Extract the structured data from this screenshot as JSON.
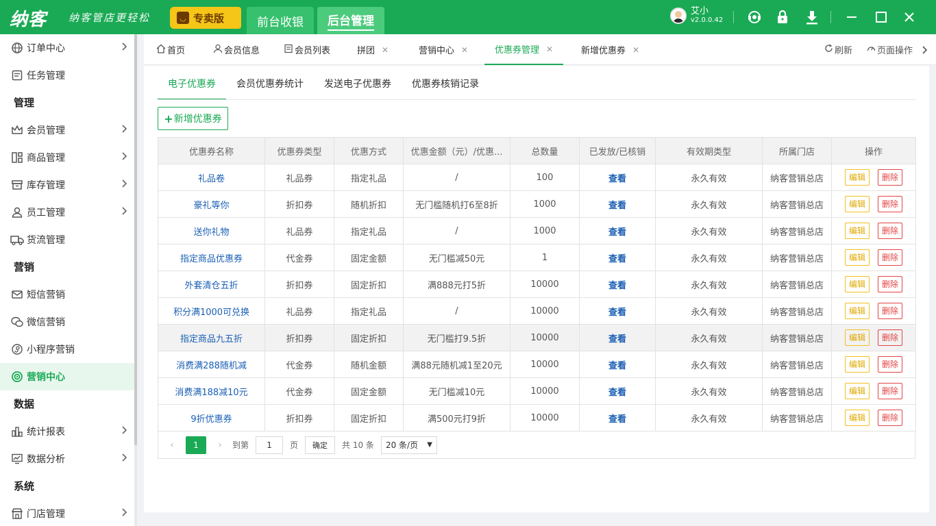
{
  "app": {
    "logo": "纳客",
    "slogan": "纳客管店更轻松",
    "edition": "专卖版",
    "top_tabs": [
      {
        "label": "前台收银"
      },
      {
        "label": "后台管理"
      }
    ],
    "user": {
      "name": "艾小",
      "version": "v2.0.0.42"
    },
    "accent_color": "#1aaa55"
  },
  "sidebar": {
    "items": [
      {
        "label": "订单中心",
        "icon": "globe-icon",
        "arrow": true
      },
      {
        "label": "任务管理",
        "icon": "task-icon",
        "arrow": false
      },
      {
        "group": "管理"
      },
      {
        "label": "会员管理",
        "icon": "crown-icon",
        "arrow": true
      },
      {
        "label": "商品管理",
        "icon": "product-icon",
        "arrow": true
      },
      {
        "label": "库存管理",
        "icon": "inventory-icon",
        "arrow": true
      },
      {
        "label": "员工管理",
        "icon": "user-icon",
        "arrow": true
      },
      {
        "label": "货流管理",
        "icon": "truck-icon",
        "arrow": false
      },
      {
        "group": "营销"
      },
      {
        "label": "短信营销",
        "icon": "mail-icon",
        "arrow": false
      },
      {
        "label": "微信营销",
        "icon": "wechat-icon",
        "arrow": false
      },
      {
        "label": "小程序营销",
        "icon": "miniapp-icon",
        "arrow": false
      },
      {
        "label": "营销中心",
        "icon": "target-icon",
        "arrow": false,
        "active": true
      },
      {
        "group": "数据"
      },
      {
        "label": "统计报表",
        "icon": "bar-chart-icon",
        "arrow": true
      },
      {
        "label": "数据分析",
        "icon": "analysis-icon",
        "arrow": true
      },
      {
        "group": "系统"
      },
      {
        "label": "门店管理",
        "icon": "store-icon",
        "arrow": true
      }
    ]
  },
  "page_tabs": {
    "tabs": [
      {
        "label": "首页",
        "icon": "home-icon",
        "closable": false
      },
      {
        "label": "会员信息",
        "icon": "person-icon",
        "closable": false
      },
      {
        "label": "会员列表",
        "icon": "list-icon",
        "closable": false
      },
      {
        "label": "拼团",
        "closable": true
      },
      {
        "label": "营销中心",
        "closable": true
      },
      {
        "label": "优惠券管理",
        "closable": true,
        "active": true
      },
      {
        "label": "新增优惠券",
        "closable": true
      }
    ],
    "refresh": "刷新",
    "page_ops": "页面操作"
  },
  "coupon": {
    "sub_tabs": [
      "电子优惠券",
      "会员优惠券统计",
      "发送电子优惠券",
      "优惠券核销记录"
    ],
    "add_button": "新增优惠券",
    "columns": [
      "优惠券名称",
      "优惠券类型",
      "优惠方式",
      "优惠金额（元）/优惠...",
      "总数量",
      "已发放/已核销",
      "有效期类型",
      "所属门店",
      "操作"
    ],
    "rows": [
      {
        "name": "礼品卷",
        "type": "礼品券",
        "method": "指定礼品",
        "amount": "/",
        "total": "100",
        "view": "查看",
        "validity": "永久有效",
        "store": "纳客营销总店"
      },
      {
        "name": "豪礼等你",
        "type": "折扣券",
        "method": "随机折扣",
        "amount": "无门槛随机打6至8折",
        "total": "1000",
        "view": "查看",
        "validity": "永久有效",
        "store": "纳客营销总店"
      },
      {
        "name": "送你礼物",
        "type": "礼品券",
        "method": "指定礼品",
        "amount": "/",
        "total": "1000",
        "view": "查看",
        "validity": "永久有效",
        "store": "纳客营销总店"
      },
      {
        "name": "指定商品优惠券",
        "type": "代金券",
        "method": "固定金额",
        "amount": "无门槛减50元",
        "total": "1",
        "view": "查看",
        "validity": "永久有效",
        "store": "纳客营销总店"
      },
      {
        "name": "外套清仓五折",
        "type": "折扣券",
        "method": "固定折扣",
        "amount": "满888元打5折",
        "total": "10000",
        "view": "查看",
        "validity": "永久有效",
        "store": "纳客营销总店"
      },
      {
        "name": "积分满1000可兑换",
        "type": "礼品券",
        "method": "指定礼品",
        "amount": "/",
        "total": "10000",
        "view": "查看",
        "validity": "永久有效",
        "store": "纳客营销总店"
      },
      {
        "name": "指定商品九五折",
        "type": "折扣券",
        "method": "固定折扣",
        "amount": "无门槛打9.5折",
        "total": "10000",
        "view": "查看",
        "validity": "永久有效",
        "store": "纳客营销总店",
        "highlight": true
      },
      {
        "name": "消费满288随机减",
        "type": "代金券",
        "method": "随机金额",
        "amount": "满88元随机减1至20元",
        "total": "10000",
        "view": "查看",
        "validity": "永久有效",
        "store": "纳客营销总店"
      },
      {
        "name": "消费满188减10元",
        "type": "代金券",
        "method": "固定金额",
        "amount": "无门槛减10元",
        "total": "10000",
        "view": "查看",
        "validity": "永久有效",
        "store": "纳客营销总店"
      },
      {
        "name": "9折优惠券",
        "type": "折扣券",
        "method": "固定折扣",
        "amount": "满500元打9折",
        "total": "10000",
        "view": "查看",
        "validity": "永久有效",
        "store": "纳客营销总店"
      }
    ],
    "row_actions": {
      "edit": "编辑",
      "delete": "删除"
    },
    "pager": {
      "current": "1",
      "goto_label": "到第",
      "goto_value": "1",
      "page_unit": "页",
      "confirm": "确定",
      "total": "共 10 条",
      "page_size": "20 条/页"
    }
  }
}
